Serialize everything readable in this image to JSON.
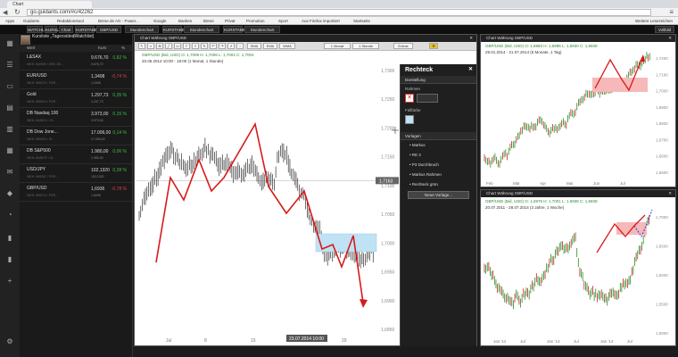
{
  "browser": {
    "tab_title": "Chart",
    "url": "go.guidants.com/#c/42262",
    "bookmarks": [
      "Apps",
      "Guidants",
      "Redaktionstool",
      "Börse.de AG - Power...",
      "Google",
      "Banken",
      "Börse",
      "Privat",
      "Promotion",
      "Sport",
      "Aus Firefox importiert",
      "Startseite"
    ],
    "other_bookmarks": "Weitere Lesezeichen"
  },
  "header": {
    "buttons": [
      "WATCHLIST ÖFFNEN",
      "KURSLISTE ÖFFNEN",
      "Chart",
      "KURSTABELLE ÖFFNEN",
      "GBP/USD",
      "Stundenchart",
      "KURSTABELLE ÖFFNEN",
      "Stundenchart",
      "KURSTABELLE ÖFFNEN",
      "Stundenchart"
    ],
    "right_button": "Vollbild"
  },
  "watchlist": {
    "title": "Kursliste „Tagesvideo",
    "subtitle": "(Watchlist)",
    "col_wert": "Wert",
    "col_kurs": "Kurs",
    "col_pct": "%",
    "rows": [
      {
        "name": "L&SAX",
        "wkn": "WKN: 846900 / ISIN: DE...",
        "price": "9.676,70",
        "small": "9.676,70",
        "pct": "0,82 %",
        "dir": "up"
      },
      {
        "name": "EUR/USD",
        "wkn": "WKN: 965275 / FOR...",
        "price": "1,3408",
        "small": "1,3408",
        "pct": "-0,74 %",
        "dir": "dn"
      },
      {
        "name": "Gold",
        "wkn": "WKN: 965515 / FOR...",
        "price": "1.297,73",
        "small": "1.297,73",
        "pct": "0,35 %",
        "dir": "up"
      },
      {
        "name": "DB Nasdaq 100",
        "wkn": "WKN: A0AE1X / IS...",
        "price": "3.973,00",
        "small": "3.973,00",
        "pct": "0,15 %",
        "dir": "up"
      },
      {
        "name": "DB Dow Jone...",
        "wkn": "WKN: 969420 / IS...",
        "price": "17.006,00",
        "small": "17.006,00",
        "pct": "0,14 %",
        "dir": "up"
      },
      {
        "name": "DB S&P500",
        "wkn": "WKN: A0AET0 / IS...",
        "price": "1.980,00",
        "small": "1.980,00",
        "pct": "0,06 %",
        "dir": "up"
      },
      {
        "name": "USD/JPY",
        "wkn": "WKN: 965267 / FOR...",
        "price": "102,1320",
        "small": "102,1320",
        "pct": "0,28 %",
        "dir": "up"
      },
      {
        "name": "GBP/USD",
        "wkn": "WKN: 965274 / FOR...",
        "price": "1,6936",
        "small": "1,6936",
        "pct": "-0,78 %",
        "dir": "dn"
      }
    ]
  },
  "center_chart": {
    "title": "Chart Währung GBP/USD",
    "toolbar": [
      "SMA",
      "EMA",
      "WMA",
      "1 Monat",
      "1 Stunde",
      "Extras"
    ],
    "legend1": "GBP/USD (Bid, USD)  O: 1,7008  H: 1,7008  L: 1,7004  C: 1,7004",
    "legend2": "20.06.2014 10:00 - 18:00 (1 Monat, 1 Stunde)",
    "price_labels": [
      "1,7300",
      "1,7250",
      "1,7200",
      "1,7150",
      "1,7100",
      "1,7050",
      "1,7000",
      "1,6950",
      "1,6900",
      "1,6850"
    ],
    "current_price": "1,7163",
    "x_labels": [
      "Jul",
      "8",
      "15",
      "22",
      "29"
    ],
    "crosshair_date": "23.07.2014 10:00"
  },
  "drawing_panel": {
    "title": "Rechteck",
    "section_settings": "Darstellung",
    "label_rahmen": "Rahmen",
    "label_fuellfarbe": "Füllfarbe",
    "section_vorlagen": "Vorlagen",
    "templates": [
      "Markus",
      "RE 2",
      "P3 Durchbruch",
      "Markus Rahmen",
      "Rechteck grün"
    ],
    "new_template_button": "Neue Vorlage..."
  },
  "right_top_chart": {
    "title": "Chart Währung GBP/USD",
    "legend1": "GBP/USD (Bid, USD)  O: 1,6983  H: 1,6995  L: 1,6930  C: 1,6938",
    "legend2": "29.01.2014 - 21.07.2014 (6 Monate, 1 Tag)",
    "price_labels": [
      "1,7200",
      "1,7100",
      "1,7000",
      "1,6900",
      "1,6800",
      "1,6700",
      "1,6600",
      "1,6500"
    ],
    "x_labels": [
      "Feb",
      "Mär",
      "Apr",
      "Mai",
      "Jun",
      "Jul"
    ]
  },
  "right_bottom_chart": {
    "title": "Chart Währung GBP/USD",
    "legend1": "GBP/USD (Bid, USD)  O: 1,6976  H: 1,7001  L: 1,6938  C: 1,6938",
    "legend2": "20.07.2011 - 28.07.2014 (3 Jahre, 1 Woche)",
    "price_labels": [
      "1,7000",
      "1,6500",
      "1,6000",
      "1,5500",
      "1,5000"
    ],
    "x_labels": [
      "Jan '12",
      "Jul",
      "Jan '13",
      "Jul",
      "Jan '14",
      "Jul"
    ]
  }
}
